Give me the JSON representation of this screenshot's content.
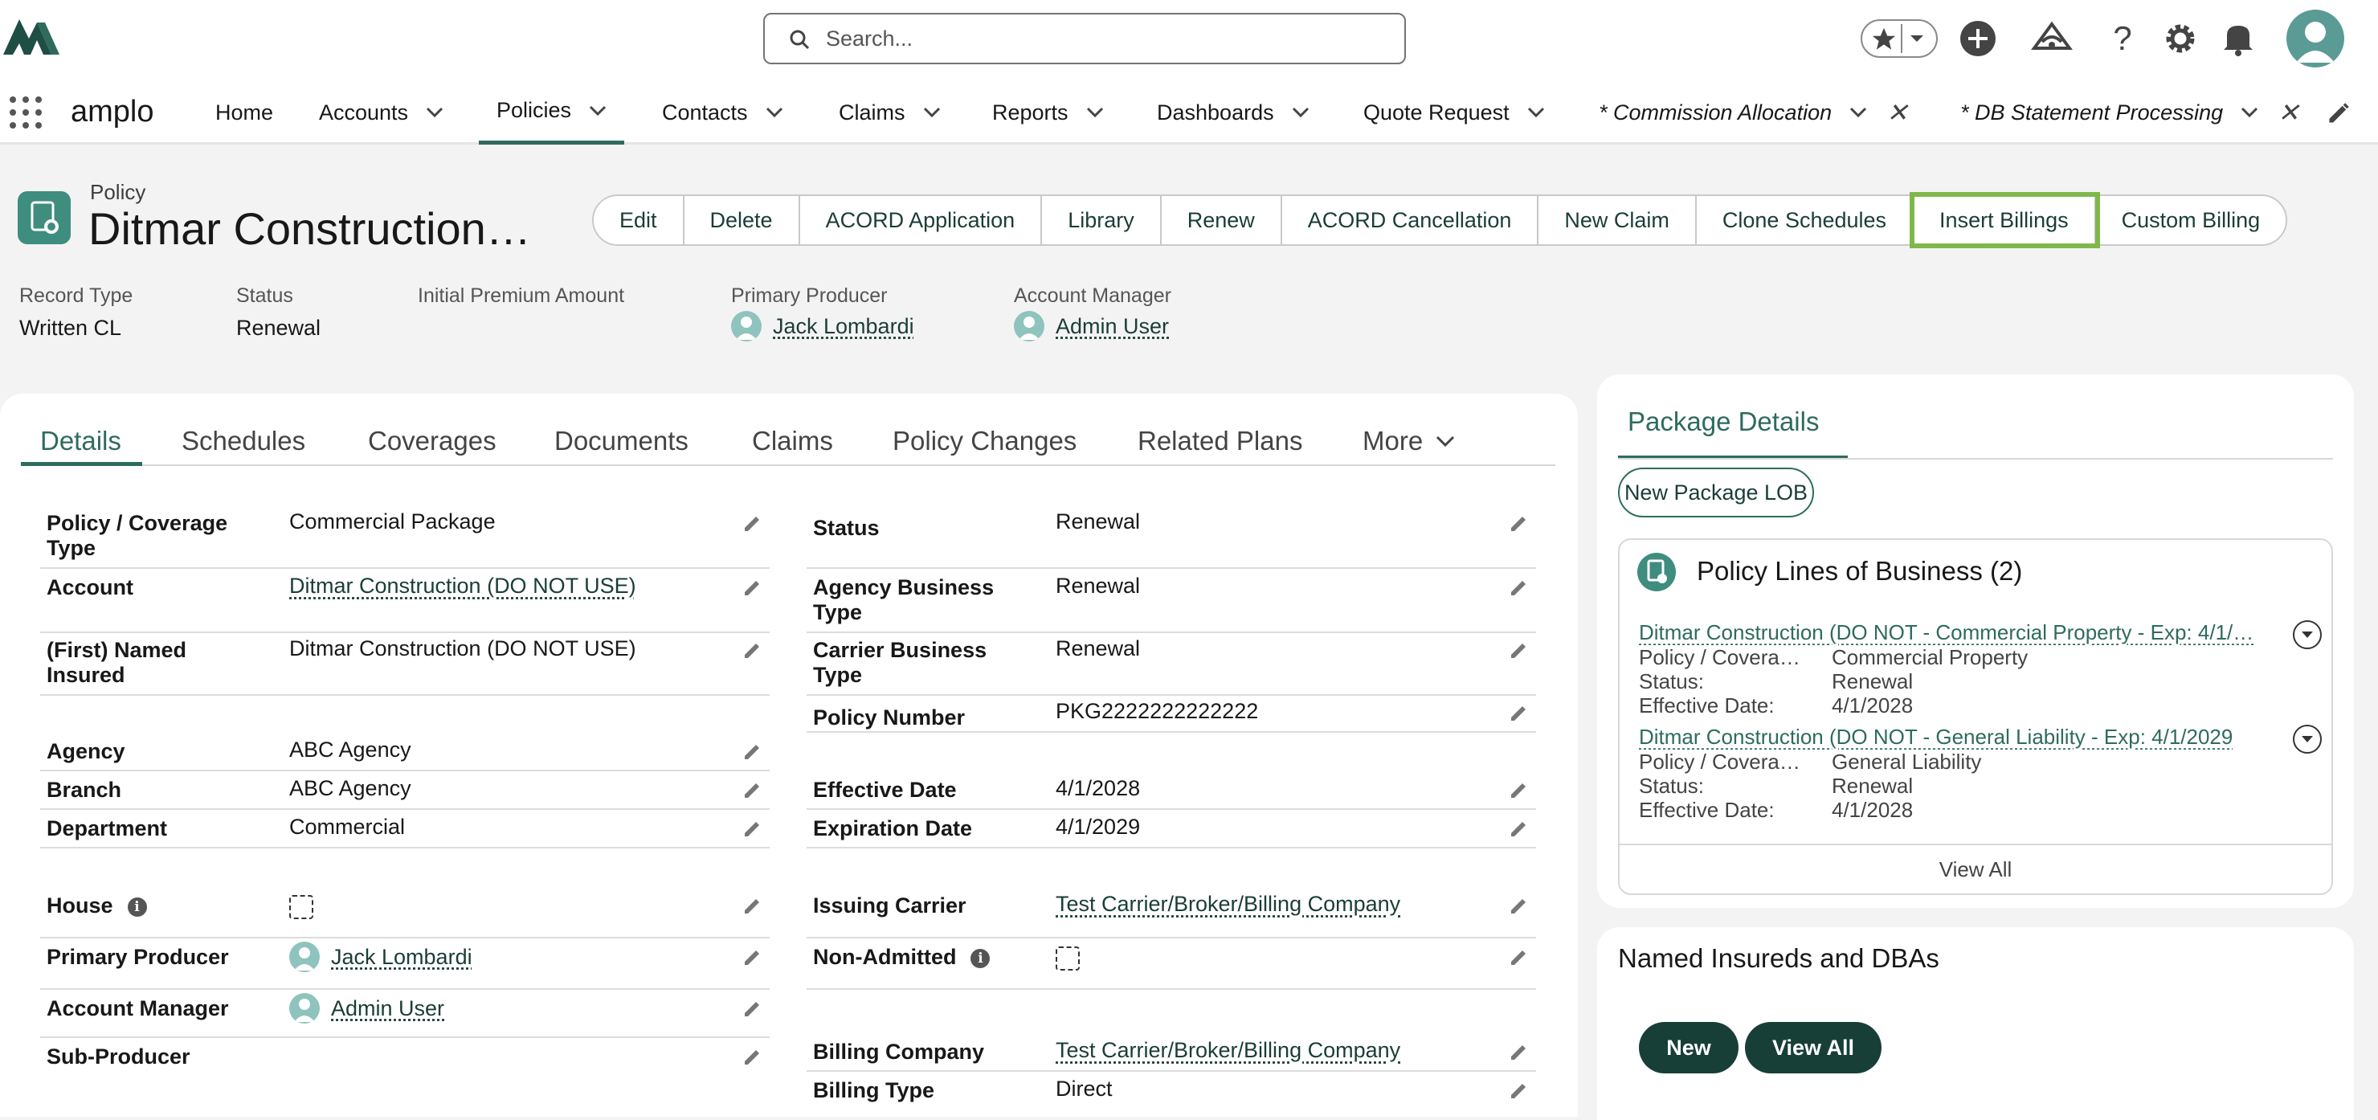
{
  "app": {
    "name": "amplo"
  },
  "search": {
    "placeholder": "Search..."
  },
  "nav": {
    "items": [
      {
        "label": "Home"
      },
      {
        "label": "Accounts"
      },
      {
        "label": "Policies"
      },
      {
        "label": "Contacts"
      },
      {
        "label": "Claims"
      },
      {
        "label": "Reports"
      },
      {
        "label": "Dashboards"
      },
      {
        "label": "Quote Request"
      },
      {
        "label": "* Commission Allocation"
      },
      {
        "label": "* DB Statement Processing"
      }
    ],
    "active": "Policies"
  },
  "header": {
    "object_label": "Policy",
    "title": "Ditmar Construction…",
    "actions": [
      "Edit",
      "Delete",
      "ACORD Application",
      "Library",
      "Renew",
      "ACORD Cancellation",
      "New Claim",
      "Clone Schedules",
      "Insert Billings",
      "Custom Billing"
    ],
    "highlighted_action": "Insert Billings",
    "fields": [
      {
        "label": "Record Type",
        "value": "Written CL"
      },
      {
        "label": "Status",
        "value": "Renewal"
      },
      {
        "label": "Initial Premium Amount",
        "value": ""
      },
      {
        "label": "Primary Producer",
        "value": "Jack Lombardi"
      },
      {
        "label": "Account Manager",
        "value": "Admin User"
      }
    ]
  },
  "tabs": [
    "Details",
    "Schedules",
    "Coverages",
    "Documents",
    "Claims",
    "Policy Changes",
    "Related Plans",
    "More"
  ],
  "details": {
    "left": [
      {
        "label": "Policy / Coverage Type",
        "value": "Commercial Package"
      },
      {
        "label": "Account",
        "value": "Ditmar Construction (DO NOT USE)"
      },
      {
        "label": "(First) Named Insured",
        "value": "Ditmar Construction (DO NOT USE)"
      },
      {
        "label": "Agency",
        "value": "ABC Agency"
      },
      {
        "label": "Branch",
        "value": "ABC Agency"
      },
      {
        "label": "Department",
        "value": "Commercial"
      },
      {
        "label": "House",
        "value": ""
      },
      {
        "label": "Primary Producer",
        "value": "Jack Lombardi"
      },
      {
        "label": "Account Manager",
        "value": "Admin User"
      },
      {
        "label": "Sub-Producer",
        "value": ""
      }
    ],
    "right": [
      {
        "label": "Status",
        "value": "Renewal"
      },
      {
        "label": "Agency Business Type",
        "value": "Renewal"
      },
      {
        "label": "Carrier Business Type",
        "value": "Renewal"
      },
      {
        "label": "Policy Number",
        "value": "PKG2222222222222"
      },
      {
        "label": "Effective Date",
        "value": "4/1/2028"
      },
      {
        "label": "Expiration Date",
        "value": "4/1/2029"
      },
      {
        "label": "Issuing Carrier",
        "value": "Test Carrier/Broker/Billing Company"
      },
      {
        "label": "Non-Admitted",
        "value": ""
      },
      {
        "label": "Billing Company",
        "value": "Test Carrier/Broker/Billing Company"
      },
      {
        "label": "Billing Type",
        "value": "Direct"
      }
    ]
  },
  "package": {
    "tab": "Package Details",
    "new_button": "New Package LOB",
    "lob_title": "Policy Lines of Business (2)",
    "lobs": [
      {
        "link": "Ditmar Construction (DO NOT - Commercial Property - Exp: 4/1/…",
        "k1": "Policy / Covera…",
        "v1": "Commercial Property",
        "k2": "Status:",
        "v2": "Renewal",
        "k3": "Effective Date:",
        "v3": "4/1/2028"
      },
      {
        "link": "Ditmar Construction (DO NOT - General Liability - Exp: 4/1/2029",
        "k1": "Policy / Covera…",
        "v1": "General Liability",
        "k2": "Status:",
        "v2": "Renewal",
        "k3": "Effective Date:",
        "v3": "4/1/2028"
      }
    ],
    "view_all": "View All"
  },
  "named_insureds": {
    "title": "Named Insureds and DBAs",
    "new_label": "New",
    "view_all_label": "View All"
  },
  "colors": {
    "accent": "#2e6b5e",
    "highlight": "#7fb84a",
    "dark_button": "#173f37"
  }
}
